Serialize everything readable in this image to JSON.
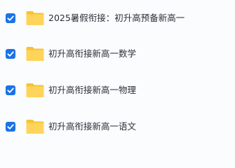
{
  "file_list": {
    "items": [
      {
        "name": "2025暑假衔接：初升高预备新高一",
        "checked": true,
        "icon": "folder-icon"
      },
      {
        "name": "初升高衔接新高一数学",
        "checked": true,
        "icon": "folder-icon"
      },
      {
        "name": "初升高衔接新高一物理",
        "checked": true,
        "icon": "folder-icon"
      },
      {
        "name": "初升高衔接新高一语文",
        "checked": true,
        "icon": "folder-icon"
      }
    ]
  },
  "colors": {
    "checkbox": "#1a73e8",
    "folder_front": "#ffd45a",
    "folder_back": "#f7c331",
    "background": "#fbfcfe"
  }
}
